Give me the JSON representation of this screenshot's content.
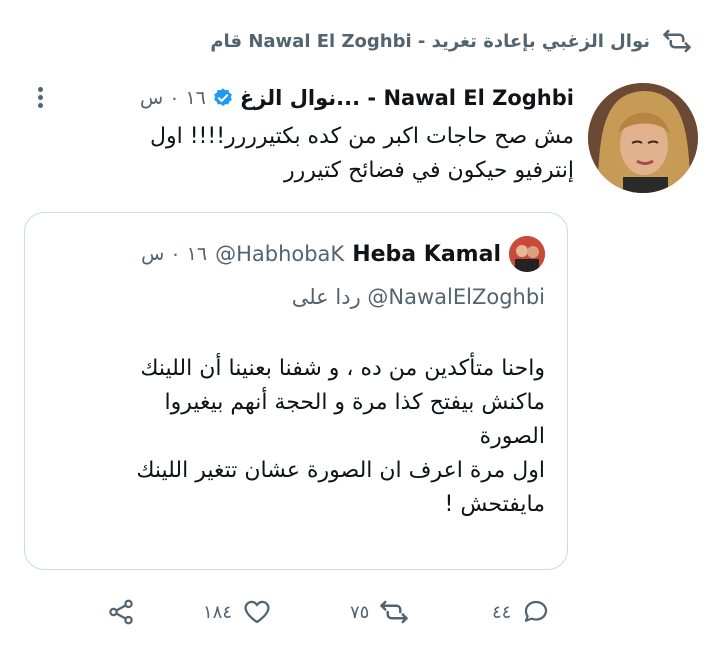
{
  "retweet": {
    "text": "قام Nawal El Zoghbi - نوال الزغبي بإعادة تغريد",
    "icon": "retweet-icon"
  },
  "tweet": {
    "author_display": "نوال الزغ... - Nawal El Zoghbi",
    "verified_icon": "verified-badge-icon",
    "time": "١٦ ٠ س",
    "text": "مش صح حاجات اكبر من كده بكتيرررر!!!! اول\nإنترفيو حيكون في فضائح كتيررر",
    "more_icon": "more-options-icon"
  },
  "quote": {
    "name": "Heba Kamal",
    "handle": "@HabhobaK",
    "time": "١٦ ٠ س",
    "reply_to": "ردا على @NawalElZoghbi",
    "text": "واحنا متأكدين من ده ، و شفنا بعنينا أن اللينك\nماكنش بيفتح كذا مرة و الحجة أنهم بيغيروا\nالصورة\nاول مرة اعرف ان الصورة عشان تتغير اللينك\nمايفتحش !"
  },
  "actions": {
    "reply_count": "٤٤",
    "retweet_count": "٧٥",
    "like_count": "١٨٤",
    "share_icon": "share-icon"
  },
  "colors": {
    "verified": "#1d9bf0",
    "secondary_text": "#536471",
    "border": "#cfd9de"
  }
}
